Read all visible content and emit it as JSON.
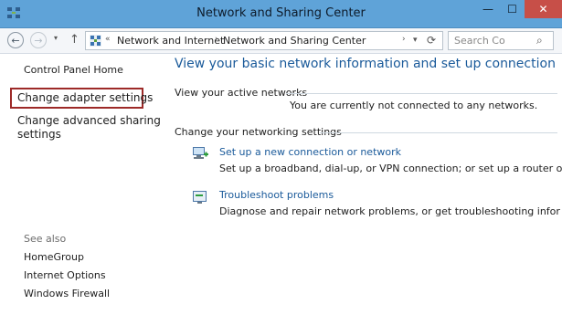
{
  "window": {
    "title": "Network and Sharing Center",
    "minimize": "—",
    "maximize": "☐",
    "close": "✕"
  },
  "nav": {
    "back": "←",
    "forward": "→",
    "recent": "▾",
    "up": "↑",
    "address_prefix": "«",
    "breadcrumbs": [
      "Network and Internet",
      "Network and Sharing Center"
    ],
    "breadcrumb_sep": "›",
    "address_dropdown": "▾",
    "refresh": "⟳",
    "search_placeholder": "Search Co",
    "search_icon": "⌕"
  },
  "left": {
    "control_panel_home": "Control Panel Home",
    "change_adapter": "Change adapter settings",
    "change_sharing": "Change advanced sharing settings",
    "see_also_label": "See also",
    "see_also": [
      "HomeGroup",
      "Internet Options",
      "Windows Firewall"
    ]
  },
  "main": {
    "heading": "View your basic network information and set up connection",
    "active_networks_label": "View your active networks",
    "status": "You are currently not connected to any networks.",
    "change_settings_label": "Change your networking settings",
    "items": [
      {
        "link": "Set up a new connection or network",
        "desc": "Set up a broadband, dial-up, or VPN connection; or set up a router oint.",
        "icon": "network-setup-icon"
      },
      {
        "link": "Troubleshoot problems",
        "desc": "Diagnose and repair network problems, or get troubleshooting infor",
        "icon": "troubleshoot-icon"
      }
    ]
  },
  "colors": {
    "titlebar": "#5fa3d8",
    "link": "#1a5a9a",
    "highlight_border": "#9d2a28",
    "close_button": "#c74f48"
  }
}
